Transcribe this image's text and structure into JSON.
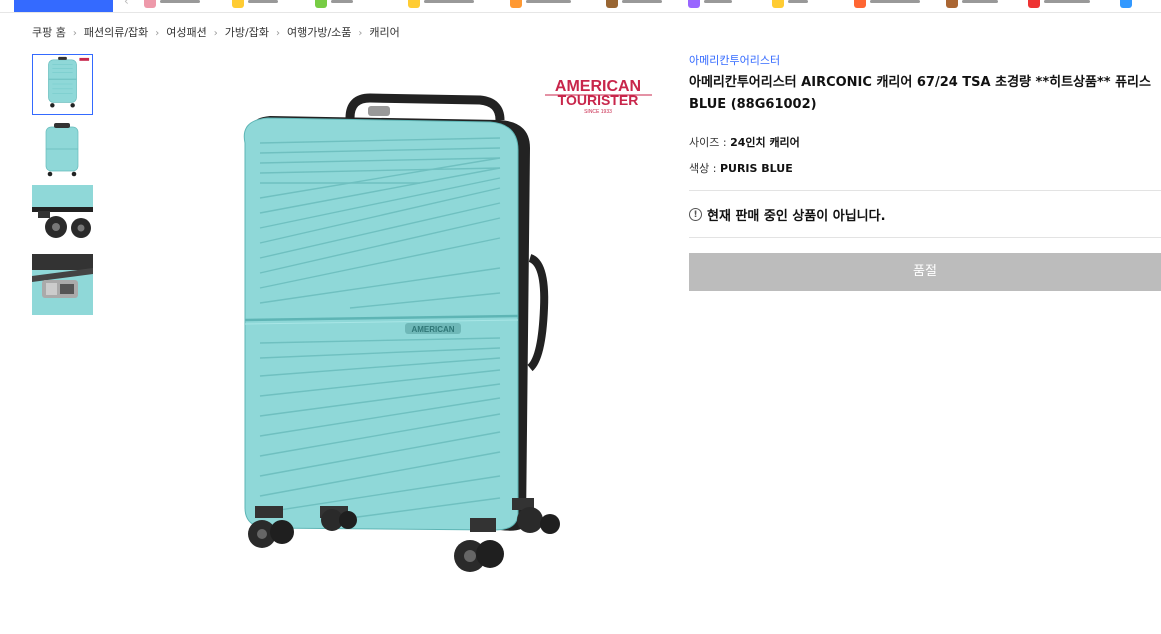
{
  "breadcrumb": [
    "쿠팡 홈",
    "패션의류/잡화",
    "여성패션",
    "가방/잡화",
    "여행가방/소품",
    "캐리어"
  ],
  "thumbnails": [
    {
      "name": "thumbnail-front",
      "active": true
    },
    {
      "name": "thumbnail-back",
      "active": false
    },
    {
      "name": "thumbnail-wheels",
      "active": false
    },
    {
      "name": "thumbnail-lock",
      "active": false
    }
  ],
  "main_image": {
    "logo_line1": "AMERICAN",
    "logo_line2": "TOURISTER",
    "logo_line3": "SINCE 1933",
    "body_badge": "AMERICAN",
    "color": "#8fd8d8"
  },
  "product": {
    "brand": "아메리칸투어리스터",
    "title_line1": "아메리칸투어리스터 AIRCONIC 캐리어 67/24 TSA 초경량 **히트상품** 퓨리스",
    "title_line2": "BLUE (88G61002)",
    "size_label": "사이즈 : ",
    "size_value": "24인치 캐리어",
    "color_label": "색상 : ",
    "color_value": "PURIS BLUE",
    "notice_icon": "!",
    "notice": "현재 판매 중인 상품이 아닙니다.",
    "soldout_button": "품절"
  },
  "colors": {
    "accent": "#346aff",
    "soldout_bg": "#bcbcbc",
    "brand_red": "#c8264b"
  }
}
